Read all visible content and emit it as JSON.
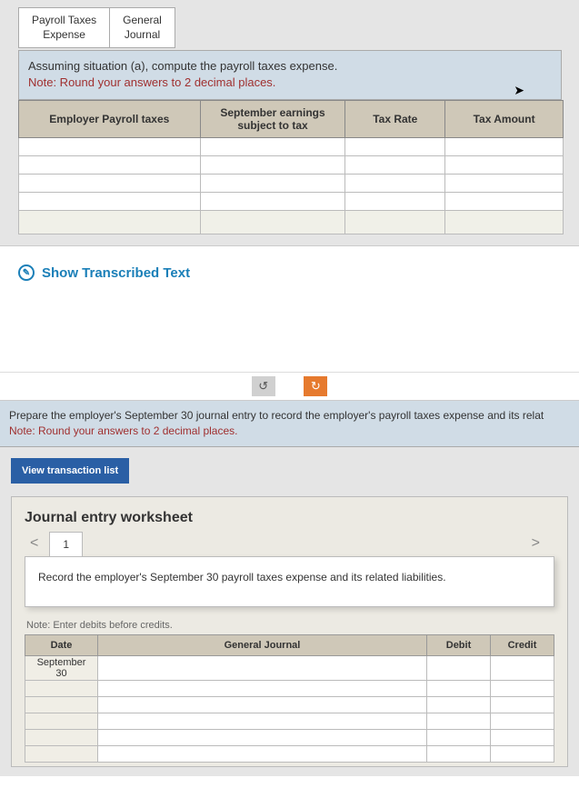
{
  "top_tabs": {
    "tab1_line1": "Payroll Taxes",
    "tab1_line2": "Expense",
    "tab2_line1": "General",
    "tab2_line2": "Journal"
  },
  "instruction1_main": "Assuming situation (a), compute the payroll taxes expense.",
  "instruction1_note": "Note: Round your answers to 2 decimal places.",
  "payroll_headers": {
    "col1": "Employer Payroll taxes",
    "col2": "September earnings subject to tax",
    "col3": "Tax Rate",
    "col4": "Tax Amount"
  },
  "transcribed_link": "Show Transcribed Text",
  "nav": {
    "undo": "↺",
    "redo": "↻"
  },
  "instruction2_main": "Prepare the employer's September 30 journal entry to record the employer's payroll taxes expense and its relat",
  "instruction2_note": "Note: Round your answers to 2 decimal places.",
  "view_transaction": "View transaction list",
  "journal_title": "Journal entry worksheet",
  "jtab_label": "1",
  "record_text": "Record the employer's September 30 payroll taxes expense and its related liabilities.",
  "note_debits": "Note: Enter debits before credits.",
  "journal_headers": {
    "date": "Date",
    "gj": "General Journal",
    "debit": "Debit",
    "credit": "Credit"
  },
  "journal_date": {
    "line1": "September",
    "line2": "30"
  },
  "arrows": {
    "left": "<",
    "right": ">"
  }
}
